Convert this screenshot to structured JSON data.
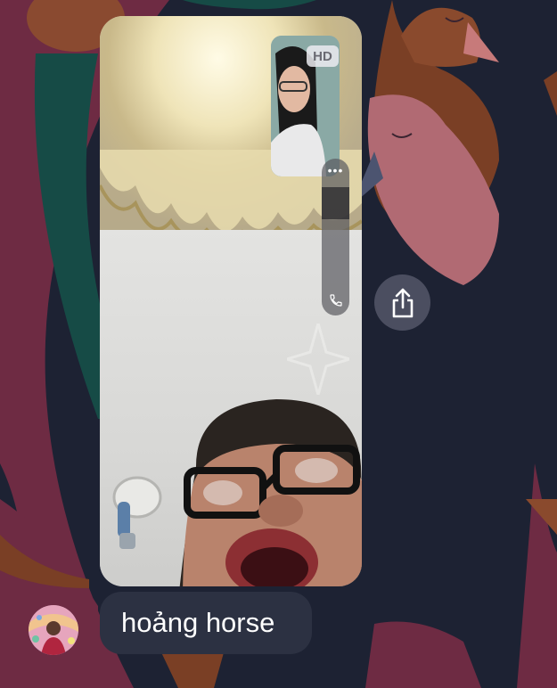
{
  "call": {
    "quality_badge": "HD",
    "more_label": "•••"
  },
  "message": {
    "text": "hoảng horse"
  },
  "colors": {
    "background": "#1d2233",
    "bubble": "#2c3142",
    "shape_maroon": "#6e2b43",
    "shape_green": "#164b46",
    "shape_brown": "#7a3f25",
    "shape_pink": "#b16a73",
    "shape_slate": "#4c5470"
  },
  "icons": {
    "share": "share-icon",
    "phone": "phone-icon",
    "more": "more-icon"
  }
}
